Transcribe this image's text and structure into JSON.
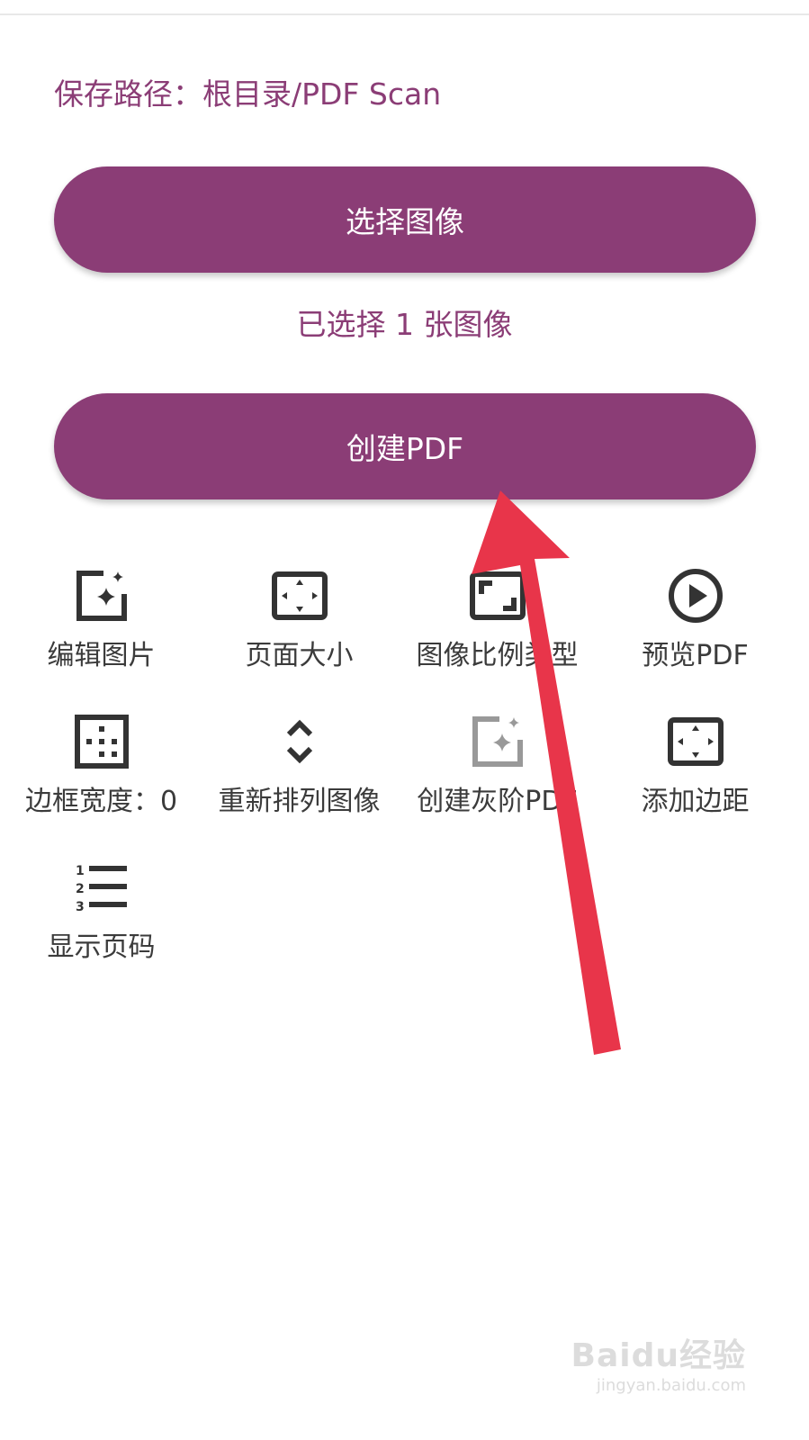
{
  "save_path": "保存路径：根目录/PDF Scan",
  "select_button": "选择图像",
  "selected_count": "已选择 1 张图像",
  "create_button": "创建PDF",
  "options": [
    {
      "label": "编辑图片",
      "icon": "edit-image-icon"
    },
    {
      "label": "页面大小",
      "icon": "page-size-icon"
    },
    {
      "label": "图像比例类型",
      "icon": "image-scale-icon"
    },
    {
      "label": "预览PDF",
      "icon": "play-icon"
    },
    {
      "label": "边框宽度：0",
      "icon": "border-icon"
    },
    {
      "label": "重新排列图像",
      "icon": "reorder-icon"
    },
    {
      "label": "创建灰阶PDF",
      "icon": "grayscale-icon"
    },
    {
      "label": "添加边距",
      "icon": "margin-icon"
    },
    {
      "label": "显示页码",
      "icon": "page-numbers-icon"
    }
  ],
  "watermark": {
    "logo": "Baidu经验",
    "url": "jingyan.baidu.com"
  },
  "colors": {
    "accent": "#8b3d76",
    "annotation_arrow": "#e8354a"
  }
}
